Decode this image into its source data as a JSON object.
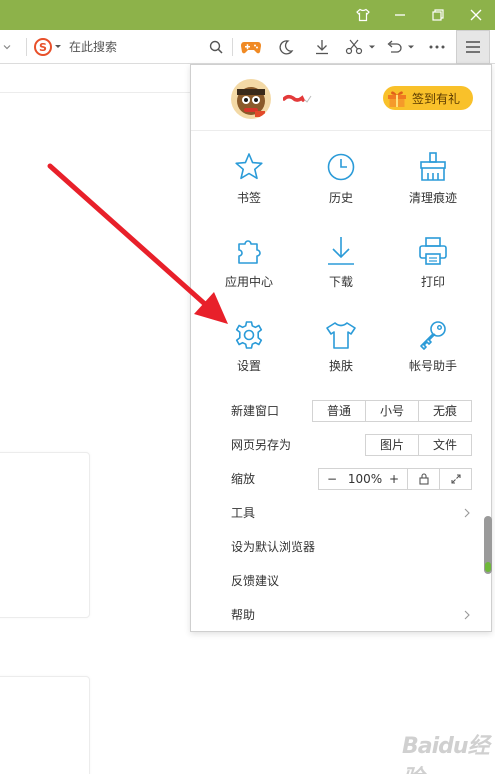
{
  "toolbar": {
    "search_placeholder": "在此搜索"
  },
  "menu": {
    "signin_label": "签到有礼",
    "grid": [
      {
        "label": "书签",
        "icon": "star-icon"
      },
      {
        "label": "历史",
        "icon": "clock-icon"
      },
      {
        "label": "清理痕迹",
        "icon": "broom-icon"
      },
      {
        "label": "应用中心",
        "icon": "puzzle-icon"
      },
      {
        "label": "下载",
        "icon": "download-icon"
      },
      {
        "label": "打印",
        "icon": "printer-icon"
      },
      {
        "label": "设置",
        "icon": "gear-icon"
      },
      {
        "label": "换肤",
        "icon": "tshirt-icon"
      },
      {
        "label": "帐号助手",
        "icon": "key-icon"
      }
    ],
    "new_window": {
      "label": "新建窗口",
      "options": [
        "普通",
        "小号",
        "无痕"
      ]
    },
    "save_page": {
      "label": "网页另存为",
      "options": [
        "图片",
        "文件"
      ]
    },
    "zoom": {
      "label": "缩放",
      "minus": "−",
      "value": "100%",
      "plus": "+"
    },
    "tools_label": "工具",
    "default_browser_label": "设为默认浏览器",
    "feedback_label": "反馈建议",
    "help_label": "帮助"
  },
  "watermark": "Baidu经验",
  "colors": {
    "titlebar": "#8db24a",
    "icon_blue": "#2b9bd8",
    "signin_yellow": "#f9c12a",
    "arrow_red": "#e8202a"
  }
}
